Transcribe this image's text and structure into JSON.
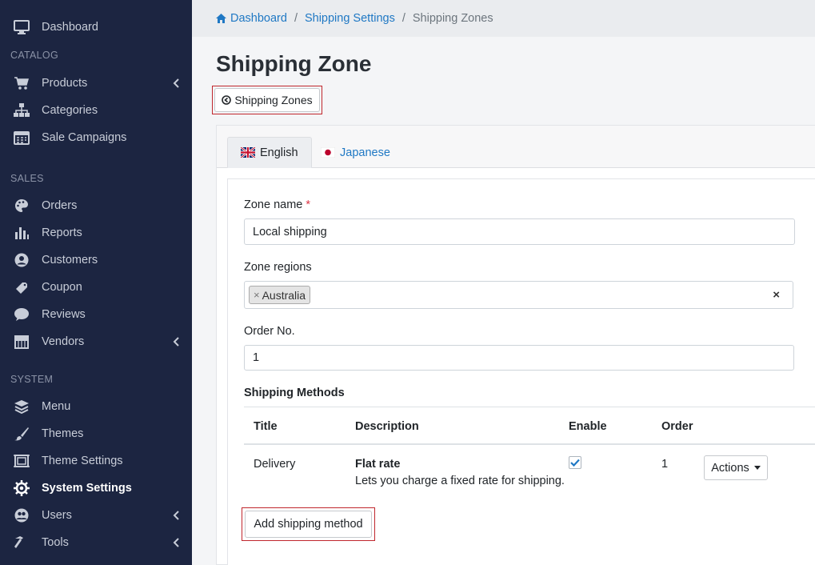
{
  "colors": {
    "sidebar_bg": "#1c2541",
    "link": "#1f78c4",
    "highlight_border": "#c0272d",
    "checkbox_check": "#1f78c4"
  },
  "sidebar": {
    "items": [
      {
        "label": "Dashboard",
        "icon": "monitor-icon"
      },
      {
        "label": "Products",
        "icon": "cart-icon",
        "has_children": true
      },
      {
        "label": "Categories",
        "icon": "sitemap-icon"
      },
      {
        "label": "Sale Campaigns",
        "icon": "calendar-icon"
      },
      {
        "label": "Orders",
        "icon": "palette-icon"
      },
      {
        "label": "Reports",
        "icon": "bar-chart-icon"
      },
      {
        "label": "Customers",
        "icon": "user-circle-icon"
      },
      {
        "label": "Coupon",
        "icon": "ticket-icon"
      },
      {
        "label": "Reviews",
        "icon": "comment-icon"
      },
      {
        "label": "Vendors",
        "icon": "store-icon",
        "has_children": true
      },
      {
        "label": "Menu",
        "icon": "layers-icon"
      },
      {
        "label": "Themes",
        "icon": "brush-icon"
      },
      {
        "label": "Theme Settings",
        "icon": "frame-icon"
      },
      {
        "label": "System Settings",
        "icon": "gear-icon",
        "active": true
      },
      {
        "label": "Users",
        "icon": "users-icon",
        "has_children": true
      },
      {
        "label": "Tools",
        "icon": "hammer-icon",
        "has_children": true
      }
    ],
    "sections": {
      "catalog": "CATALOG",
      "sales": "SALES",
      "system": "SYSTEM"
    }
  },
  "breadcrumb": {
    "home": "Dashboard",
    "parent": "Shipping Settings",
    "current": "Shipping Zones",
    "separator": "/"
  },
  "page": {
    "title": "Shipping Zone",
    "back_label": "Shipping Zones"
  },
  "tabs": [
    {
      "label": "English",
      "flag": "uk-flag-icon",
      "active": true
    },
    {
      "label": "Japanese",
      "flag": "japan-flag-icon",
      "active": false
    }
  ],
  "form": {
    "zone_name_label": "Zone name",
    "required_mark": "*",
    "zone_name_value": "Local shipping",
    "zone_regions_label": "Zone regions",
    "zone_regions_tag": "Australia",
    "tag_remove": "×",
    "clear_all": "×",
    "order_label": "Order No.",
    "order_value": "1"
  },
  "shipping_methods": {
    "title": "Shipping Methods",
    "columns": [
      "Title",
      "Description",
      "Enable",
      "Order"
    ],
    "rows": [
      {
        "title": "Delivery",
        "desc_title": "Flat rate",
        "desc_text": "Lets you charge a fixed rate for shipping.",
        "enabled": true,
        "order": "1",
        "actions_label": "Actions"
      }
    ],
    "add_label": "Add shipping method"
  }
}
